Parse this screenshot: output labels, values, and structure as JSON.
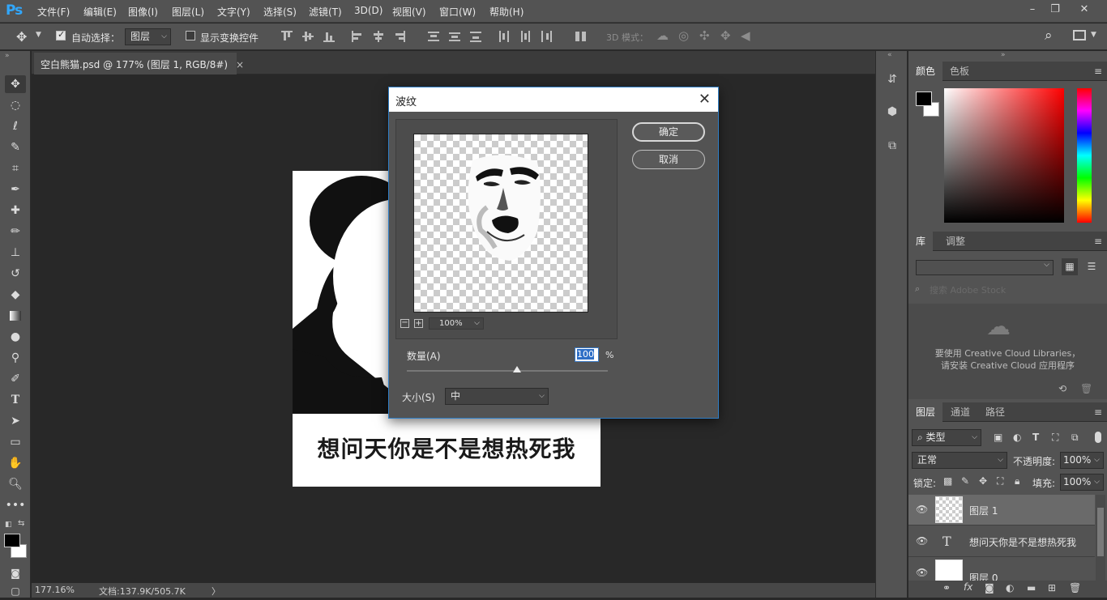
{
  "app": {
    "logo": "Ps"
  },
  "menu": [
    "文件(F)",
    "编辑(E)",
    "图像(I)",
    "图层(L)",
    "文字(Y)",
    "选择(S)",
    "滤镜(T)",
    "3D(D)",
    "视图(V)",
    "窗口(W)",
    "帮助(H)"
  ],
  "options": {
    "auto_select_label": "自动选择：",
    "auto_select_value": "图层",
    "show_transform_label": "显示变换控件",
    "mode_3d_label": "3D 模式："
  },
  "document": {
    "tab_title": "空白熊猫.psd @ 177% (图层 1, RGB/8#)",
    "close_glyph": "×",
    "caption": "想问天你是不是想热死我"
  },
  "status": {
    "zoom": "177.16%",
    "doc_info": "文档:137.9K/505.7K",
    "arrow": "〉"
  },
  "dialog": {
    "title": "波纹",
    "ok": "确定",
    "cancel": "取消",
    "preview_zoom": "100%",
    "amount_label": "数量(A)",
    "amount_value": "100",
    "amount_unit": "%",
    "amount_slider_fraction": 0.55,
    "size_label": "大小(S)",
    "size_value": "中"
  },
  "panels": {
    "color_tabs": [
      "颜色",
      "色板"
    ],
    "library_tabs": [
      "库",
      "调整"
    ],
    "library_search_placeholder": "搜索 Adobe Stock",
    "library_msg_line1": "要使用 Creative Cloud Libraries，",
    "library_msg_line2": "请安装 Creative Cloud 应用程序",
    "layer_tabs": [
      "图层",
      "通道",
      "路径"
    ],
    "filter_kind": "类型",
    "blend_mode": "正常",
    "opacity_label": "不透明度:",
    "opacity_value": "100%",
    "lock_label": "锁定:",
    "fill_label": "填充:",
    "fill_value": "100%",
    "layers": [
      {
        "name": "图层 1",
        "selected": true
      },
      {
        "name": "想问天你是不是想热死我",
        "selected": false
      },
      {
        "name": "图层 0",
        "selected": false
      }
    ]
  },
  "colors": {
    "accent": "#31a8ff",
    "selection_blue": "#2f7ec6"
  }
}
